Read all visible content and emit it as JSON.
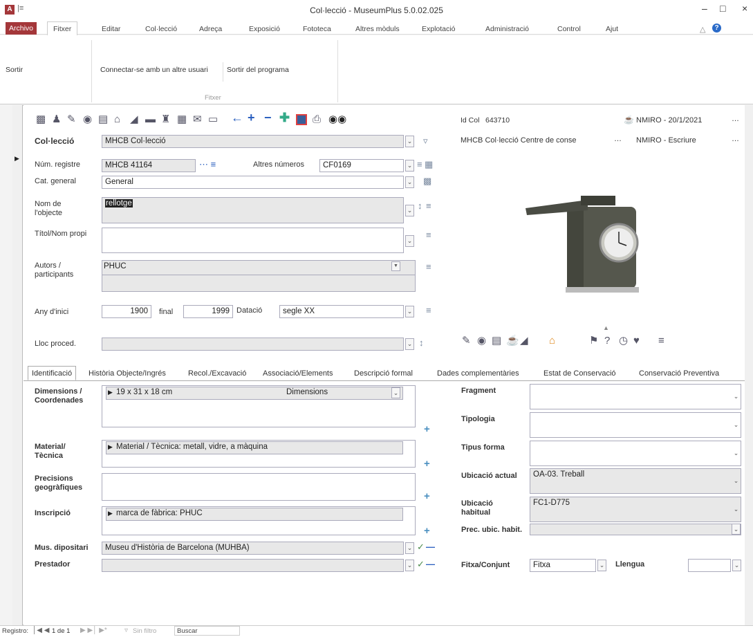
{
  "window": {
    "title": "Col·lecció - MuseumPlus 5.0.02.025",
    "qat": "|≡",
    "min": "–",
    "max": "□",
    "close": "×",
    "app_icon": "A"
  },
  "menu": {
    "archivo": "Archivo",
    "fitxer": "Fitxer",
    "items": [
      "Editar",
      "Col·lecció",
      "Adreça",
      "Exposició",
      "Fototeca",
      "Altres mòduls",
      "Explotació",
      "Administració",
      "Control",
      "Ajut"
    ]
  },
  "ribbon": {
    "buttons": [
      "Sortir",
      "Connectar-se amb un altre usuari",
      "Sortir del programa"
    ],
    "group": "Fitxer"
  },
  "toolbar_icons": [
    "save-icon",
    "user-icon",
    "pen-icon",
    "eye-icon",
    "document-icon",
    "home-icon",
    "chart-icon",
    "printer-icon",
    "people-icon",
    "calendar-icon",
    "mail-icon",
    "clipboard-icon",
    "arrow-left-icon",
    "plus-icon",
    "minus-icon",
    "move-icon",
    "record-icon",
    "print-icon",
    "binoculars-icon"
  ],
  "header": {
    "id_label": "Id Col",
    "id_value": "643710",
    "modified": "NMIRO - 20/1/2021",
    "collection_desc": "MHCB Col·lecció Centre de conse",
    "write_user": "NMIRO - Escriure",
    "more": "…"
  },
  "fields": {
    "collection_label": "Col·lecció",
    "collection_value": "MHCB Col·lecció",
    "num_registre_label": "Núm. registre",
    "num_registre_value": "MHCB 41164",
    "altres_numeros_label": "Altres números",
    "altres_numeros_value": "CF0169",
    "cat_general_label": "Cat. general",
    "cat_general_value": "General",
    "nom_objecte_label": "Nom de l'objecte",
    "nom_objecte_value": "rellotge",
    "titol_label": "Títol/Nom propi",
    "titol_value": "",
    "autors_label": "Autors / participants",
    "autors_value": "PHUC",
    "any_inici_label": "Any d'inici",
    "any_inici_value": "1900",
    "final_label": "final",
    "final_value": "1999",
    "datacio_label": "Datació",
    "datacio_value": "segle XX",
    "lloc_label": "Lloc proced.",
    "lloc_value": ""
  },
  "tabs": [
    "Identificació",
    "Història Objecte/Ingrés",
    "Recol./Excavació",
    "Associació/Elements",
    "Descripció formal",
    "Dades complementàries",
    "Estat de Conservació",
    "Conservació Preventiva"
  ],
  "ident": {
    "dimensions_label": "Dimensions / Coordenades",
    "dimensions_value": "19 x 31 x 18 cm",
    "dimensions_type": "Dimensions",
    "material_label": "Material/ Tècnica",
    "material_value": "Material / Tècnica: metall, vidre, a màquina",
    "precisions_label": "Precisions geogràfiques",
    "inscripcio_label": "Inscripció",
    "inscripcio_value": "marca de fàbrica: PHUC",
    "dipositari_label": "Mus. dipositari",
    "dipositari_value": "Museu d'Història de Barcelona (MUHBA)",
    "prestador_label": "Prestador",
    "prestador_value": "",
    "fragment_label": "Fragment",
    "tipologia_label": "Tipologia",
    "tipus_forma_label": "Tipus forma",
    "ubicacio_actual_label": "Ubicació actual",
    "ubicacio_actual_value": "OA-03. Treball",
    "ubicacio_habitual_label": "Ubicació habitual",
    "ubicacio_habitual_value": "FC1-D775",
    "prec_ubic_label": "Prec. ubic. habit.",
    "fitxa_label": "Fitxa/Conjunt",
    "fitxa_value": "Fitxa",
    "llengua_label": "Llengua",
    "llengua_value": ""
  },
  "status": {
    "registro": "Registro:",
    "pos": "1 de 1",
    "filter": "Sin filtro",
    "search": "Buscar"
  }
}
